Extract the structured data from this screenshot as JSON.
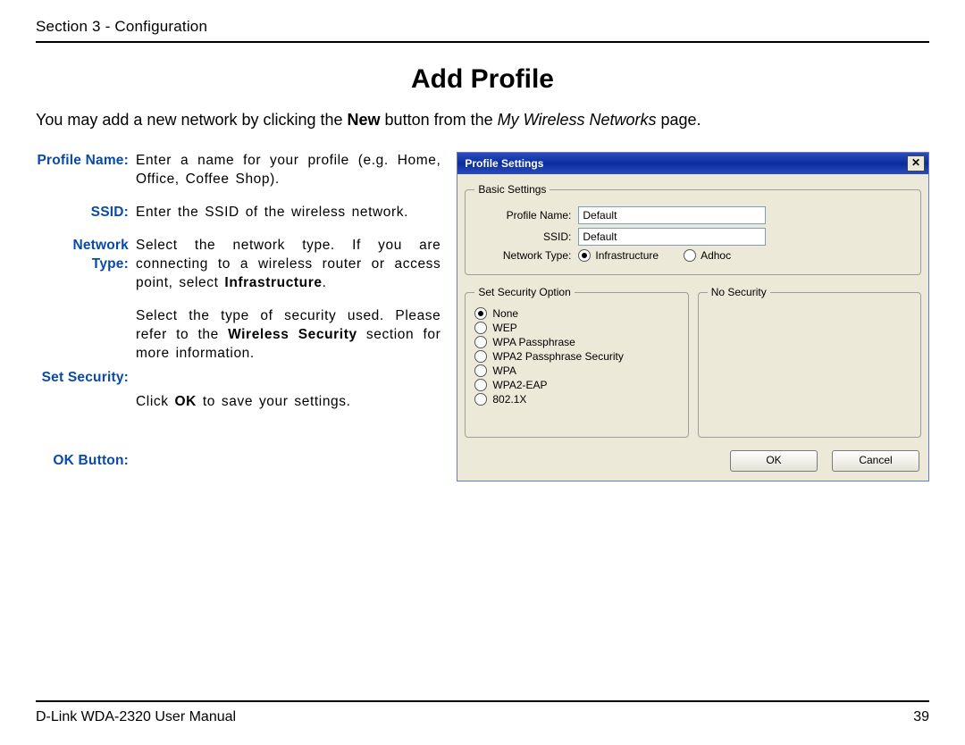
{
  "header": {
    "section": "Section 3 - Configuration"
  },
  "title": "Add Profile",
  "intro": {
    "before": "You may add a new network by clicking the ",
    "bold1": "New",
    "mid": " button from the ",
    "ital1": "My Wireless Networks",
    "after": " page."
  },
  "defs": {
    "profile_name": {
      "label": "Profile Name:",
      "desc": "Enter a name for your profile (e.g. Home, Office, Coffee Shop)."
    },
    "ssid": {
      "label": "SSID:",
      "desc": "Enter the SSID of the wireless network."
    },
    "network_type": {
      "label": "Network Type:",
      "desc_a": "Select the network type. If you are connecting to a wireless router or access point, select ",
      "desc_b_bold": "Infrastructure",
      "desc_c": "."
    },
    "set_security": {
      "label": "Set Security:",
      "desc_a": "Select the type of security used. Please refer to the ",
      "desc_b_bold": "Wireless Security",
      "desc_c": " section for more information.",
      "desc2_a": "Click ",
      "desc2_b_bold": "OK",
      "desc2_c": " to save your settings."
    },
    "ok_button": {
      "label": "OK Button:"
    }
  },
  "window": {
    "title": "Profile Settings",
    "close": "✕",
    "basic": {
      "legend": "Basic Settings",
      "profile_label": "Profile Name:",
      "profile_value": "Default",
      "ssid_label": "SSID:",
      "ssid_value": "Default",
      "nettype_label": "Network Type:",
      "nettype_opts": {
        "infra": "Infrastructure",
        "adhoc": "Adhoc"
      }
    },
    "sec": {
      "left_legend": "Set Security Option",
      "right_legend": "No Security",
      "opts": {
        "none": "None",
        "wep": "WEP",
        "wpa_pass": "WPA Passphrase",
        "wpa2_pass": "WPA2 Passphrase Security",
        "wpa": "WPA",
        "wpa2eap": "WPA2-EAP",
        "dot1x": "802.1X"
      }
    },
    "buttons": {
      "ok": "OK",
      "cancel": "Cancel"
    }
  },
  "footer": {
    "left": "D-Link WDA-2320 User Manual",
    "right": "39"
  }
}
